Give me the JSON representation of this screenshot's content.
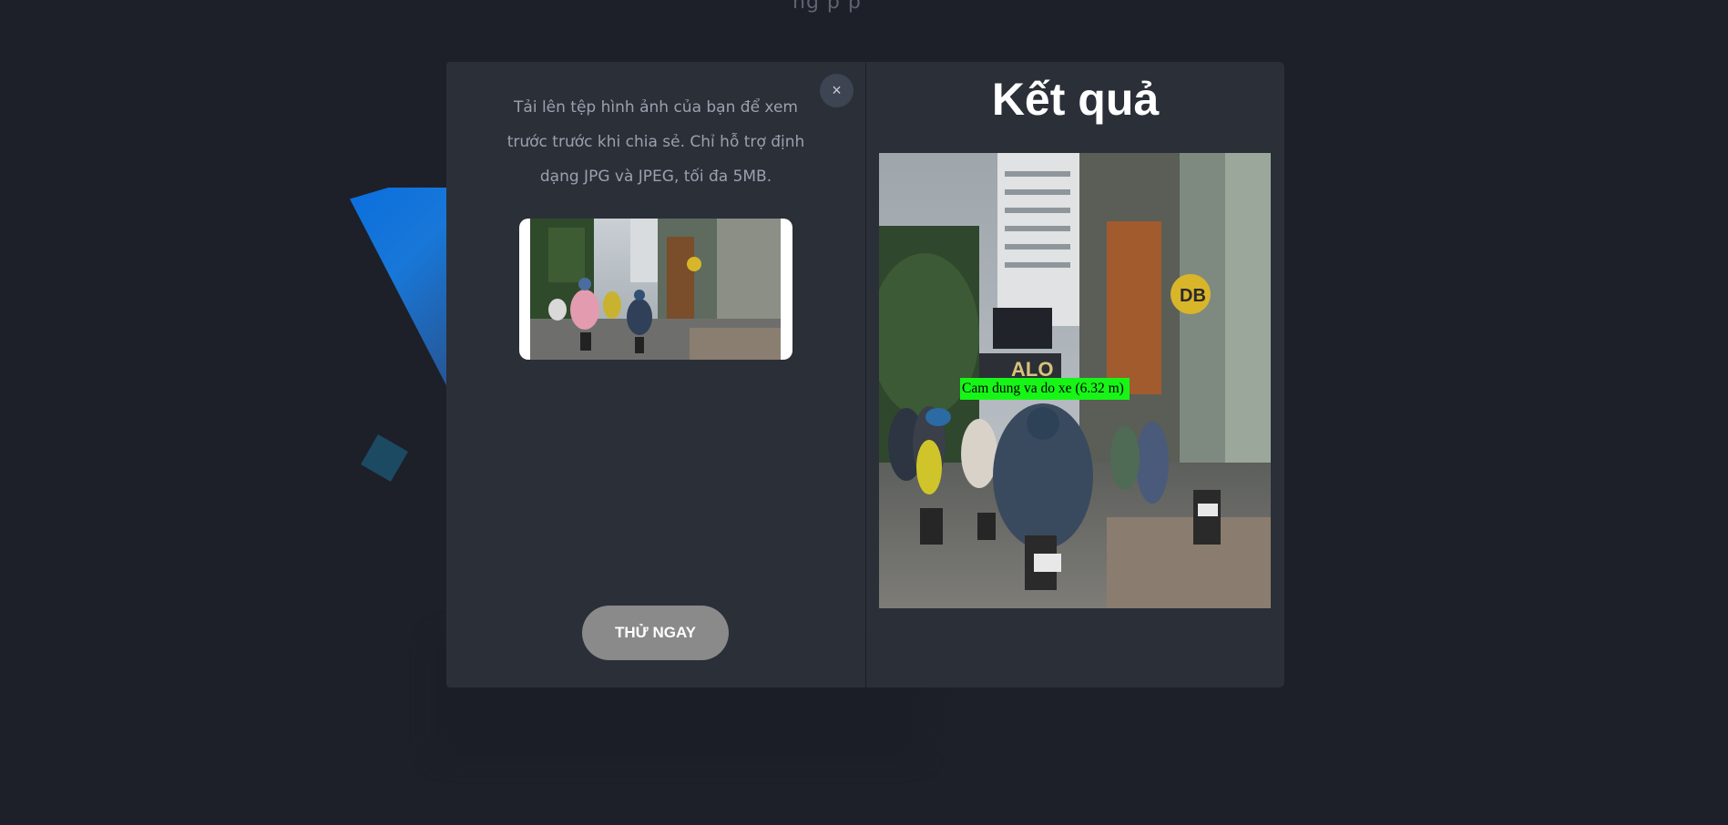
{
  "background": {
    "partial_top_text": "ng p p"
  },
  "modal": {
    "close_label": "×",
    "upload": {
      "description": "Tải lên tệp hình ảnh của bạn để xem trước trước khi chia sẻ. Chỉ hỗ trợ định dạng JPG và JPEG, tối đa 5MB.",
      "try_button": "THỬ NGAY"
    },
    "result": {
      "title": "Kết quả",
      "detection_label": "Cam dung va do xe (6.32 m)"
    }
  },
  "colors": {
    "page_bg": "#1d2029",
    "panel_bg": "#2b2f38",
    "accent_blue": "#1a7be0",
    "detection_box": "#17f517",
    "button_bg": "#8a8a8a"
  }
}
